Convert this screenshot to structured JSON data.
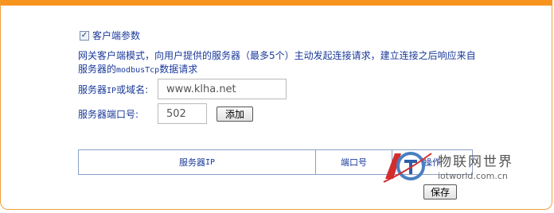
{
  "settings": {
    "enable_label": "客户端参数",
    "enabled": true,
    "desc_line1": "网关客户端模式，向用户提供的服务器（最多5个）主动发起连接请求，建立连接之后响应来自",
    "desc_line2_pre": "服务器的",
    "desc_line2_mono": "modbusTcp",
    "desc_line2_post": "数据请求"
  },
  "form": {
    "host_label_pre": "服务器",
    "host_label_mono": "IP",
    "host_label_post": "或域名:",
    "host_value": "www.klha.net",
    "port_label": "服务器端口号:",
    "port_value": "502",
    "add_button": "添加"
  },
  "table": {
    "col_ip_pre": "服务器",
    "col_ip_mono": "IP",
    "col_port": "端口号",
    "col_op": "操作"
  },
  "save_button": "保存",
  "watermark": {
    "cn": "物联网世界",
    "en": "iotworld.com.cn"
  },
  "colors": {
    "accent": "#f7941d",
    "label": "#1a3a9a"
  }
}
